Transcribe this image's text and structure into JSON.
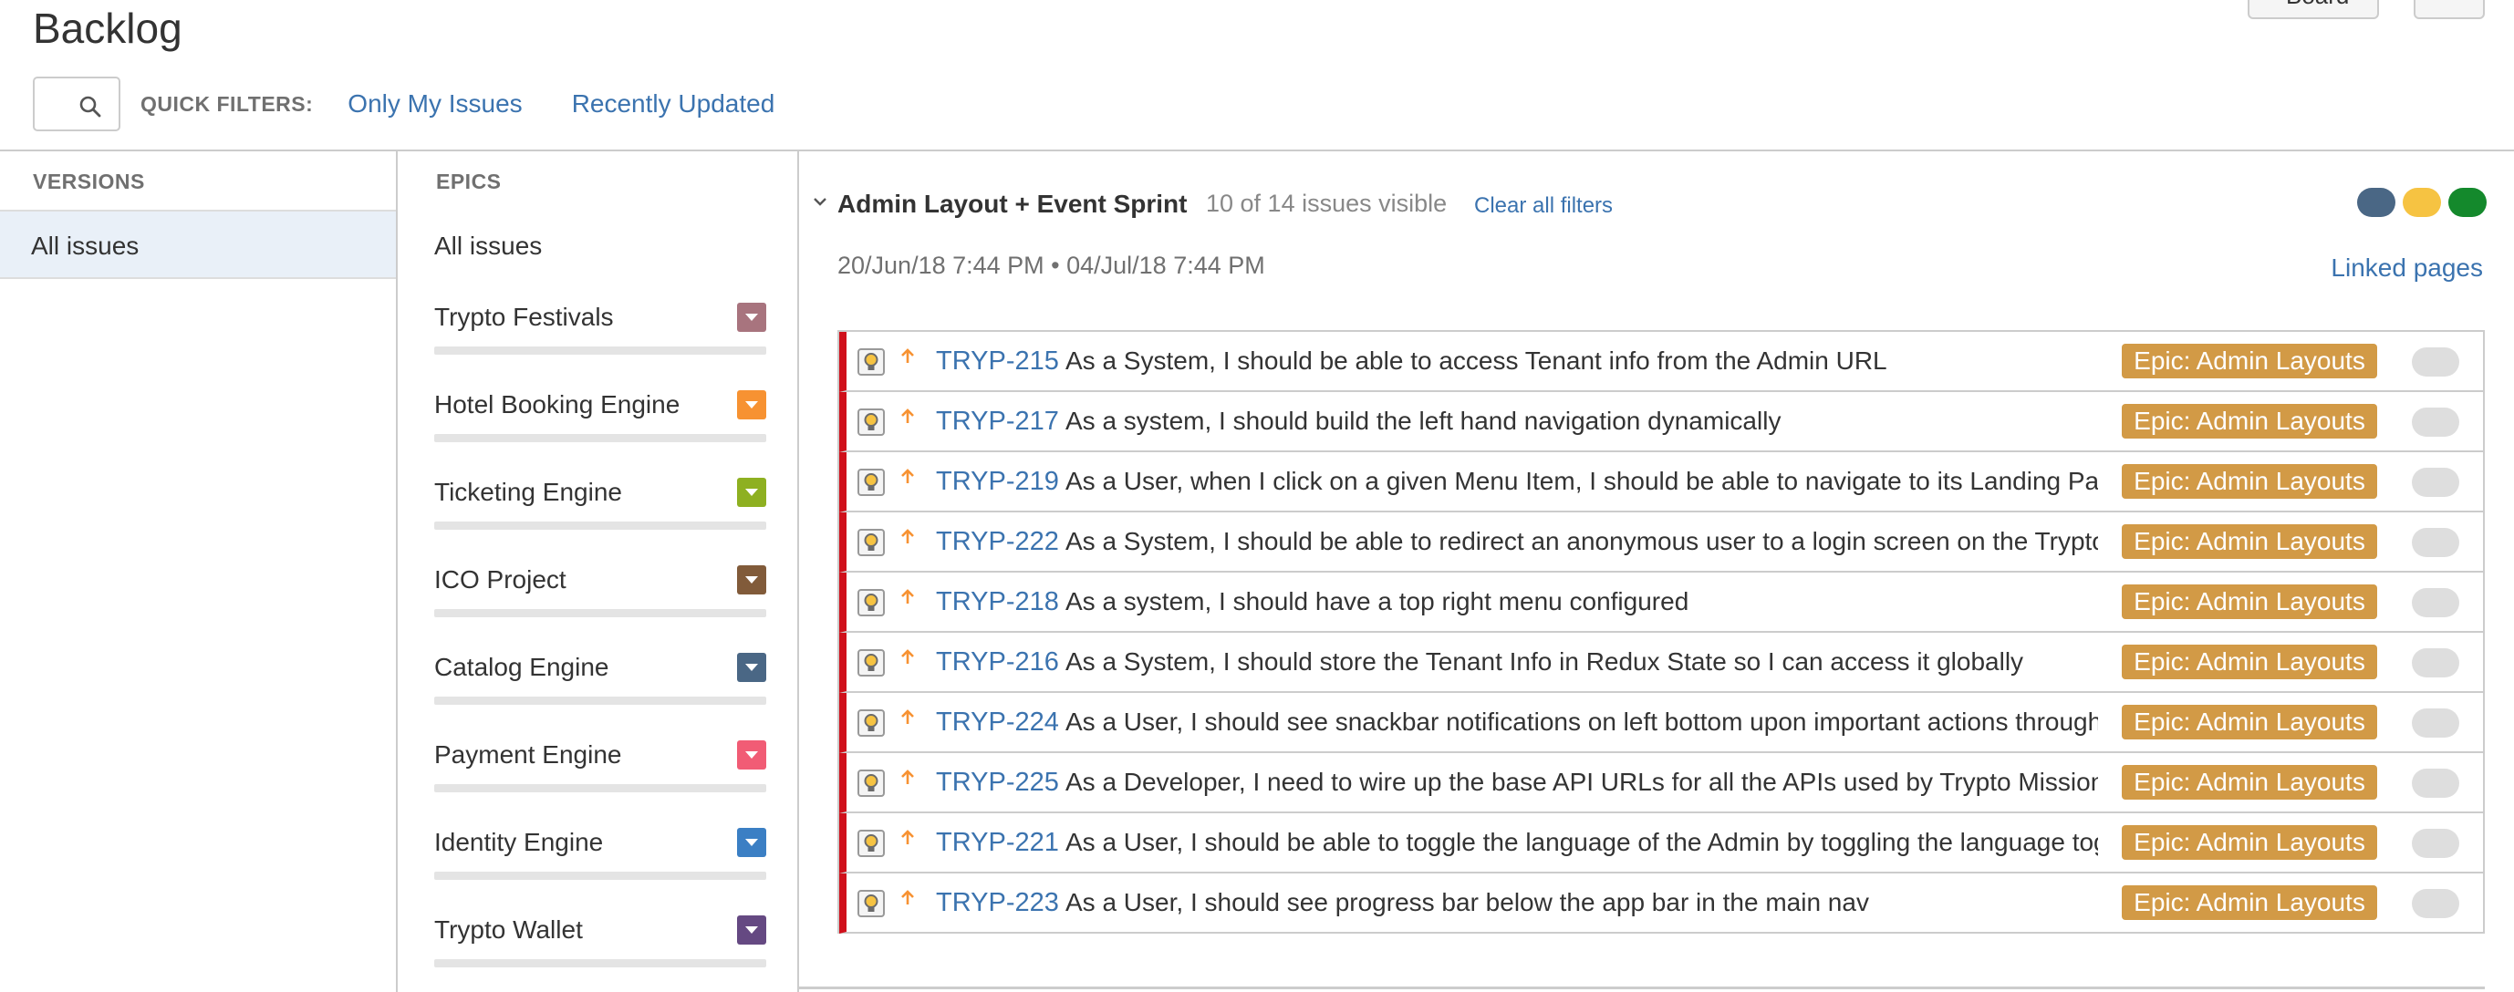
{
  "header": {
    "title": "Backlog",
    "board_button": "Board"
  },
  "filters": {
    "search_value": "",
    "label": "QUICK FILTERS:",
    "links": [
      "Only My Issues",
      "Recently Updated"
    ]
  },
  "versions": {
    "header": "VERSIONS",
    "all_issues": "All issues"
  },
  "epics": {
    "header": "EPICS",
    "all_issues": "All issues",
    "items": [
      {
        "name": "Trypto Festivals",
        "color": "#a8747e"
      },
      {
        "name": "Hotel Booking Engine",
        "color": "#f79232"
      },
      {
        "name": "Ticketing Engine",
        "color": "#8eb021"
      },
      {
        "name": "ICO Project",
        "color": "#815b3a"
      },
      {
        "name": "Catalog Engine",
        "color": "#4a6785"
      },
      {
        "name": "Payment Engine",
        "color": "#f15c75"
      },
      {
        "name": "Identity Engine",
        "color": "#3b7fc4"
      },
      {
        "name": "Trypto Wallet",
        "color": "#654982"
      }
    ]
  },
  "sprint": {
    "name": "Admin Layout + Event Sprint",
    "count": "10 of 14 issues visible",
    "clear_filters": "Clear all filters",
    "dates": "20/Jun/18 7:44 PM  •  04/Jul/18 7:44 PM",
    "linked_pages": "Linked pages",
    "status_colors": [
      "#4a6785",
      "#f6c342",
      "#14892c"
    ],
    "issues": [
      {
        "key": "TRYP-215",
        "summary": "As a System, I should be able to access Tenant info from the Admin URL",
        "epic": "Epic: Admin Layouts"
      },
      {
        "key": "TRYP-217",
        "summary": "As a system, I should build the left hand navigation dynamically",
        "epic": "Epic: Admin Layouts"
      },
      {
        "key": "TRYP-219",
        "summary": "As a User, when I click on a given Menu Item, I should be able to navigate to its Landing Page c",
        "epic": "Epic: Admin Layouts"
      },
      {
        "key": "TRYP-222",
        "summary": "As a System, I should be able to redirect an anonymous user to a login screen on the Trypto Ide",
        "epic": "Epic: Admin Layouts"
      },
      {
        "key": "TRYP-218",
        "summary": "As a system, I should have a top right menu configured",
        "epic": "Epic: Admin Layouts"
      },
      {
        "key": "TRYP-216",
        "summary": "As a System, I should store the Tenant Info in Redux State so I can access it globally",
        "epic": "Epic: Admin Layouts"
      },
      {
        "key": "TRYP-224",
        "summary": "As a User, I should see snackbar notifications on left bottom upon important actions throughout",
        "epic": "Epic: Admin Layouts"
      },
      {
        "key": "TRYP-225",
        "summary": "As a Developer, I need to wire up the base API URLs for all the APIs used by Trypto Mission Co",
        "epic": "Epic: Admin Layouts"
      },
      {
        "key": "TRYP-221",
        "summary": "As a User, I should be able to toggle the language of the Admin by toggling the language toggle",
        "epic": "Epic: Admin Layouts"
      },
      {
        "key": "TRYP-223",
        "summary": "As a User, I should see progress bar below the app bar in the main nav",
        "epic": "Epic: Admin Layouts"
      }
    ]
  }
}
